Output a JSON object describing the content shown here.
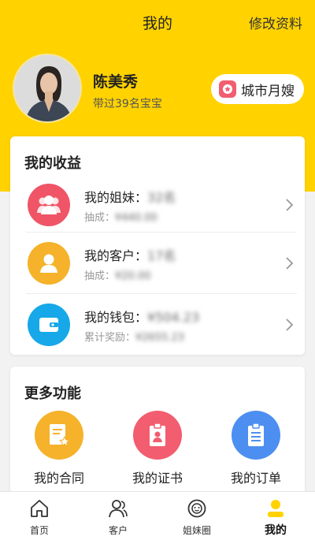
{
  "header": {
    "title": "我的",
    "edit_label": "修改资料"
  },
  "profile": {
    "name": "陈美秀",
    "subtitle": "带过39名宝宝",
    "role_badge": "城市月嫂"
  },
  "income": {
    "title": "我的收益",
    "items": [
      {
        "label": "我的姐妹：",
        "value": "32名",
        "sub_label": "抽成：",
        "sub_value": "¥440.00",
        "color": "#ef5566",
        "icon": "group-icon"
      },
      {
        "label": "我的客户：",
        "value": "17名",
        "sub_label": "抽成：",
        "sub_value": "¥20.00",
        "color": "#f5b22a",
        "icon": "person-icon"
      },
      {
        "label": "我的钱包：",
        "value": "¥504.23",
        "sub_label": "累计奖励：",
        "sub_value": "¥2655.23",
        "color": "#16a8e8",
        "icon": "wallet-icon"
      }
    ]
  },
  "more": {
    "title": "更多功能",
    "items": [
      {
        "label": "我的合同",
        "color": "#f5b22a",
        "icon": "contract-icon"
      },
      {
        "label": "我的证书",
        "color": "#f25d6f",
        "icon": "certificate-icon"
      },
      {
        "label": "我的订单",
        "color": "#4d8ff0",
        "icon": "order-icon"
      }
    ]
  },
  "tabs": [
    {
      "label": "首页",
      "icon": "home-icon"
    },
    {
      "label": "客户",
      "icon": "customers-icon"
    },
    {
      "label": "姐妹圈",
      "icon": "sisters-circle-icon"
    },
    {
      "label": "我的",
      "icon": "me-icon",
      "active": true
    }
  ],
  "colors": {
    "brand_yellow": "#ffd200",
    "background": "#f2f2f2"
  }
}
